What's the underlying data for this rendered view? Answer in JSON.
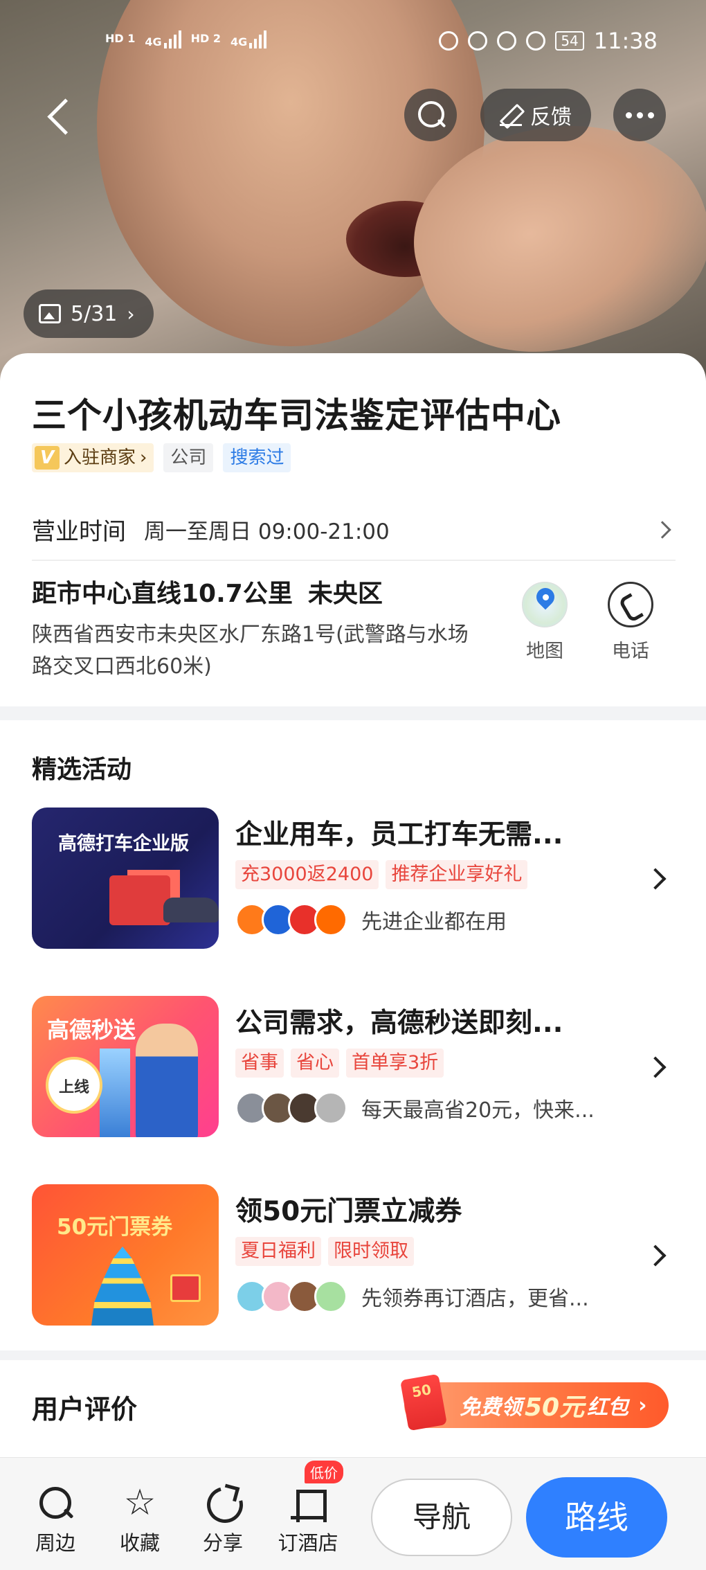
{
  "status_bar": {
    "net1": "HD 1",
    "net2": "HD 2",
    "sig1": "4G",
    "sig2": "4G",
    "battery": "54",
    "time": "11:38"
  },
  "top_actions": {
    "feedback_label": "反馈"
  },
  "photo_counter": "5/31",
  "poi": {
    "title": "三个小孩机动车司法鉴定评估中心",
    "tags": {
      "merchant": "入驻商家",
      "merchant_badge": "V",
      "category": "公司",
      "searched": "搜索过"
    },
    "hours_label": "营业时间",
    "hours_value": "周一至周日 09:00-21:00",
    "distance": "距市中心直线10.7公里",
    "district": "未央区",
    "address": "陕西省西安市未央区水厂东路1号(武警路与水场路交叉口西北60米)",
    "map_label": "地图",
    "phone_label": "电话"
  },
  "activities": {
    "section_title": "精选活动",
    "items": [
      {
        "thumb_text": "高德打车企业版",
        "title": "企业用车，员工打车无需...",
        "tags": [
          "充3000返2400",
          "推荐企业享好礼"
        ],
        "desc": "先进企业都在用"
      },
      {
        "thumb_text": "高德秒送",
        "thumb_badge": "上线",
        "title": "公司需求，高德秒送即刻...",
        "tags": [
          "省事",
          "省心",
          "首单享3折"
        ],
        "desc": "每天最高省20元，快来..."
      },
      {
        "thumb_text": "50元门票券",
        "title": "领50元门票立减券",
        "tags": [
          "夏日福利",
          "限时领取"
        ],
        "desc": "先领券再订酒店，更省..."
      }
    ]
  },
  "reviews": {
    "title": "用户评价",
    "redpack_icon_text": "50",
    "redpack_prefix": "免费领",
    "redpack_num": "50元",
    "redpack_suffix": "红包"
  },
  "bottom_bar": {
    "nearby": "周边",
    "favorite": "收藏",
    "share": "分享",
    "hotel": "订酒店",
    "low_price": "低价",
    "navigate": "导航",
    "route": "路线"
  },
  "colors": {
    "accent_blue": "#2f80ff",
    "tag_red": "#e8453c",
    "searched_blue": "#2c7be5"
  }
}
